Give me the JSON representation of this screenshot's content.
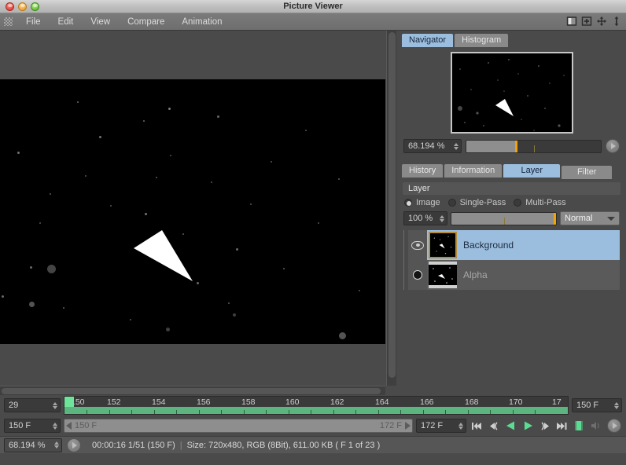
{
  "window": {
    "title": "Picture Viewer",
    "traffic_lights": [
      "close-button",
      "minimize-button",
      "zoom-button"
    ]
  },
  "menubar": {
    "grip": "grip-handle",
    "items": [
      {
        "label": "File"
      },
      {
        "label": "Edit"
      },
      {
        "label": "View"
      },
      {
        "label": "Compare"
      },
      {
        "label": "Animation"
      }
    ],
    "toolbar_icons": [
      {
        "name": "split-view-icon"
      },
      {
        "name": "add-box-icon"
      },
      {
        "name": "move-tool-icon"
      },
      {
        "name": "vertical-arrows-icon"
      }
    ]
  },
  "navigator": {
    "tabs": [
      {
        "label": "Navigator",
        "active": true
      },
      {
        "label": "Histogram",
        "active": false
      }
    ],
    "zoom_value": "68.194 %",
    "play_button": "play-icon"
  },
  "layer_panel": {
    "tabs": [
      {
        "label": "History",
        "active": false
      },
      {
        "label": "Information",
        "active": false
      },
      {
        "label": "Layer",
        "active": true
      },
      {
        "label": "Filter",
        "active": false
      }
    ],
    "section_title": "Layer",
    "modes": [
      {
        "label": "Image",
        "selected": true
      },
      {
        "label": "Single-Pass",
        "selected": false
      },
      {
        "label": "Multi-Pass",
        "selected": false
      }
    ],
    "opacity_value": "100 %",
    "blend_mode": "Normal",
    "layers": [
      {
        "name": "Background",
        "selected": true,
        "visibility_icon": "eye-icon"
      },
      {
        "name": "Alpha",
        "selected": false,
        "visibility_icon": "alpha-dot-icon"
      }
    ]
  },
  "timeline": {
    "frame_field": "29",
    "start_field": "150 F",
    "seek_label": "150 F",
    "seek_end_label": "172 F",
    "end_field": "172 F",
    "range_field": "150 F",
    "ruler_labels": [
      "150",
      "152",
      "154",
      "156",
      "158",
      "160",
      "162",
      "164",
      "166",
      "168",
      "170",
      "17"
    ],
    "transport": [
      {
        "name": "go-to-start-icon"
      },
      {
        "name": "step-back-icon"
      },
      {
        "name": "play-reverse-icon"
      },
      {
        "name": "play-forward-icon"
      },
      {
        "name": "step-forward-icon"
      },
      {
        "name": "go-to-end-icon"
      },
      {
        "name": "frames-toggle-icon"
      },
      {
        "name": "sound-toggle-icon"
      },
      {
        "name": "options-button-icon"
      }
    ]
  },
  "statusbar": {
    "zoom_value": "68.194 %",
    "play_button": "play-icon",
    "time_info": "00:00:16 1/51 (150 F)",
    "size_info": "Size: 720x480, RGB (8Bit), 611.00 KB ( F 1 of 23 )"
  },
  "colors": {
    "accent_blue": "#9cbede",
    "accent_orange": "#f0a30a",
    "accent_green": "#5cb57f",
    "panel_bg": "#4a4a4a",
    "field_bg": "#3a3a3a"
  }
}
